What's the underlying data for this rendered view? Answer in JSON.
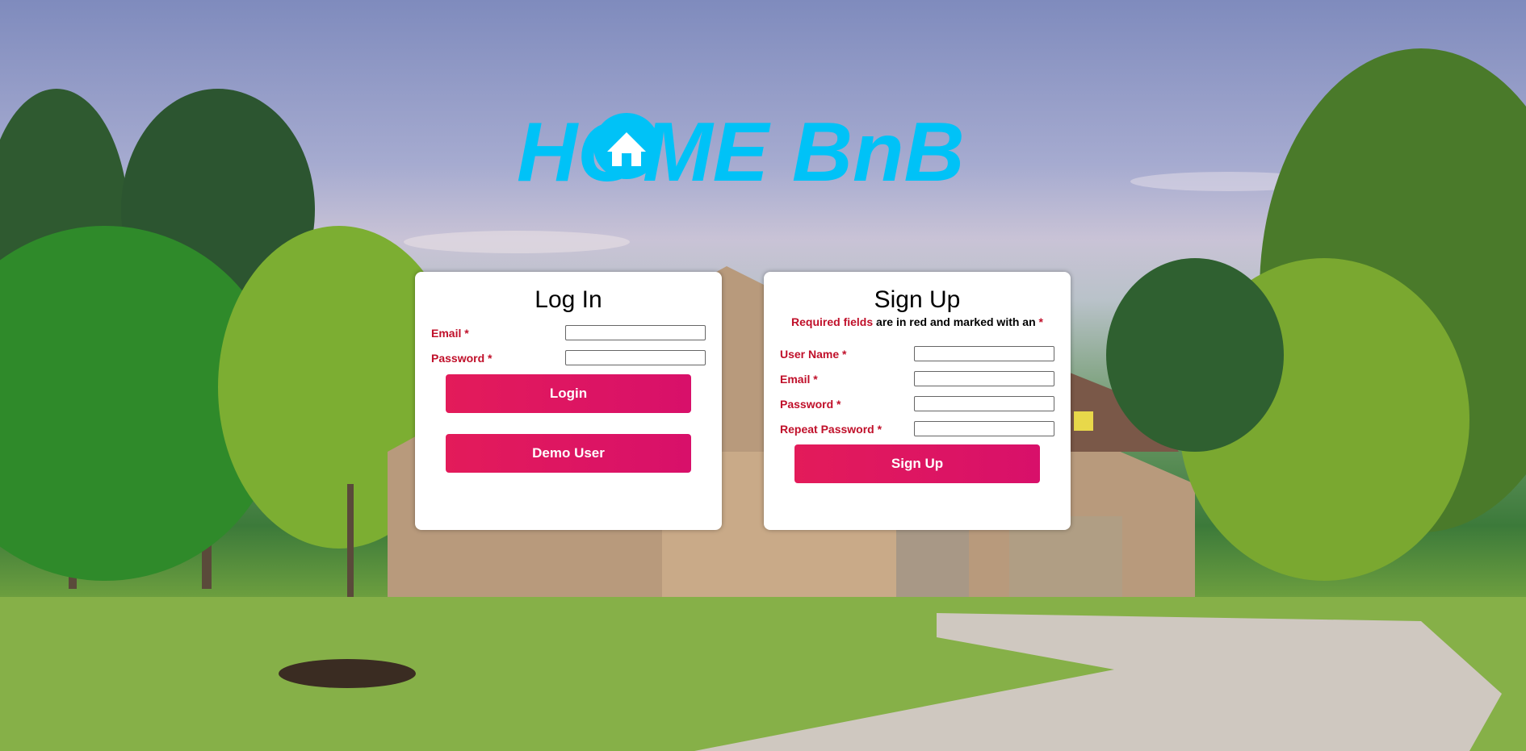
{
  "colors": {
    "accent": "#e0185e",
    "logo": "#00c2f7",
    "required": "#c0102a"
  },
  "logo": {
    "text": "HOME BnB"
  },
  "login": {
    "title": "Log In",
    "fields": [
      {
        "label": "Email *",
        "value": ""
      },
      {
        "label": "Password *",
        "value": ""
      }
    ],
    "login_button": "Login",
    "demo_button": "Demo User"
  },
  "signup": {
    "title": "Sign Up",
    "note_red": "Required fields",
    "note_rest": " are in red and marked with an ",
    "note_star": "*",
    "fields": [
      {
        "label": "User Name *",
        "value": ""
      },
      {
        "label": "Email *",
        "value": ""
      },
      {
        "label": "Password *",
        "value": ""
      },
      {
        "label": "Repeat Password *",
        "value": ""
      }
    ],
    "signup_button": "Sign Up"
  }
}
